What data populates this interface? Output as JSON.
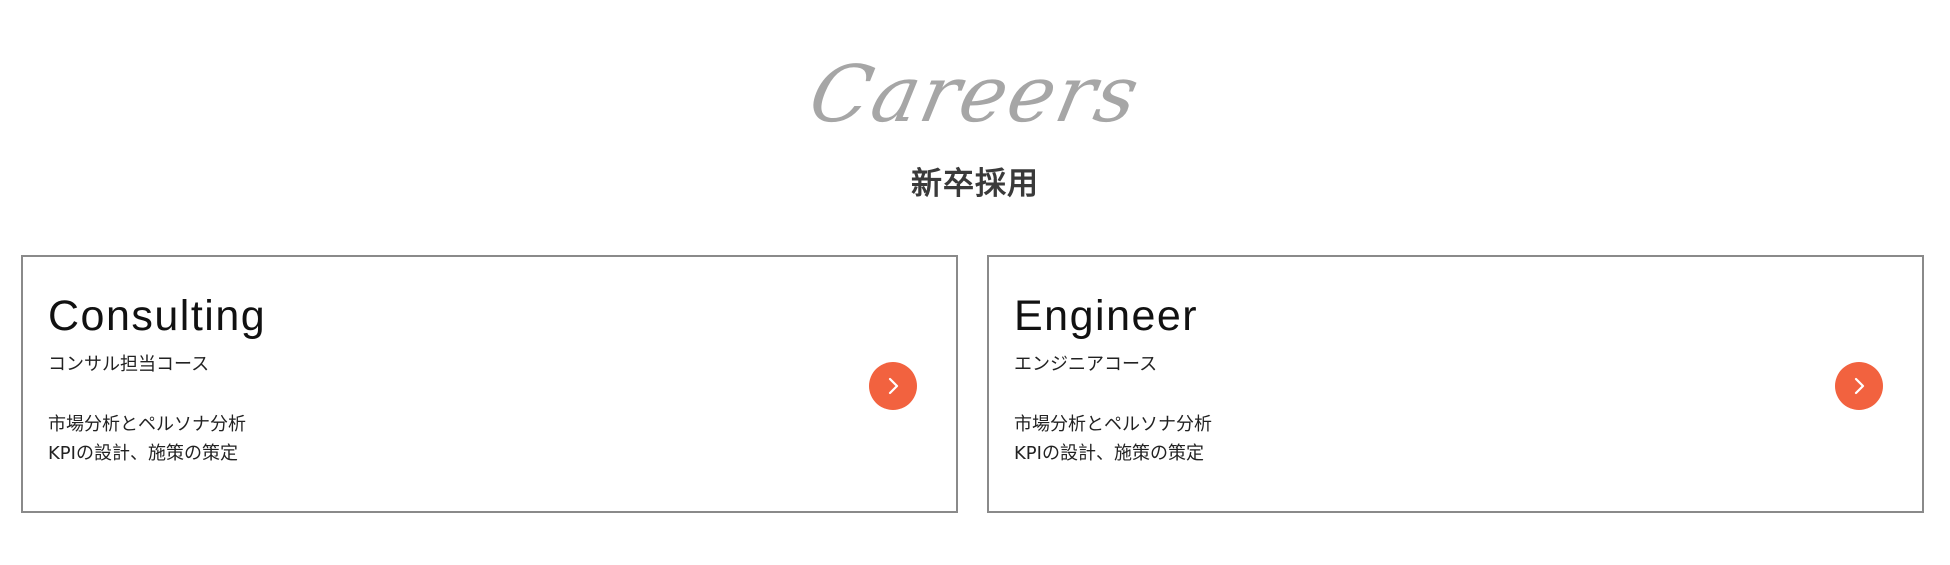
{
  "header": {
    "script_title": "Careers",
    "title": "新卒採用"
  },
  "cards": [
    {
      "title": "Consulting",
      "subtitle": "コンサル担当コース",
      "lines": [
        "市場分析とペルソナ分析",
        "KPIの設計、施策の策定"
      ],
      "icon": "chevron-right-icon"
    },
    {
      "title": "Engineer",
      "subtitle": "エンジニアコース",
      "lines": [
        "市場分析とペルソナ分析",
        "KPIの設計、施策の策定"
      ],
      "icon": "chevron-right-icon"
    }
  ],
  "colors": {
    "accent": "#f2623f",
    "script_title": "#a6a6a6",
    "card_border": "#8a8a8a"
  }
}
